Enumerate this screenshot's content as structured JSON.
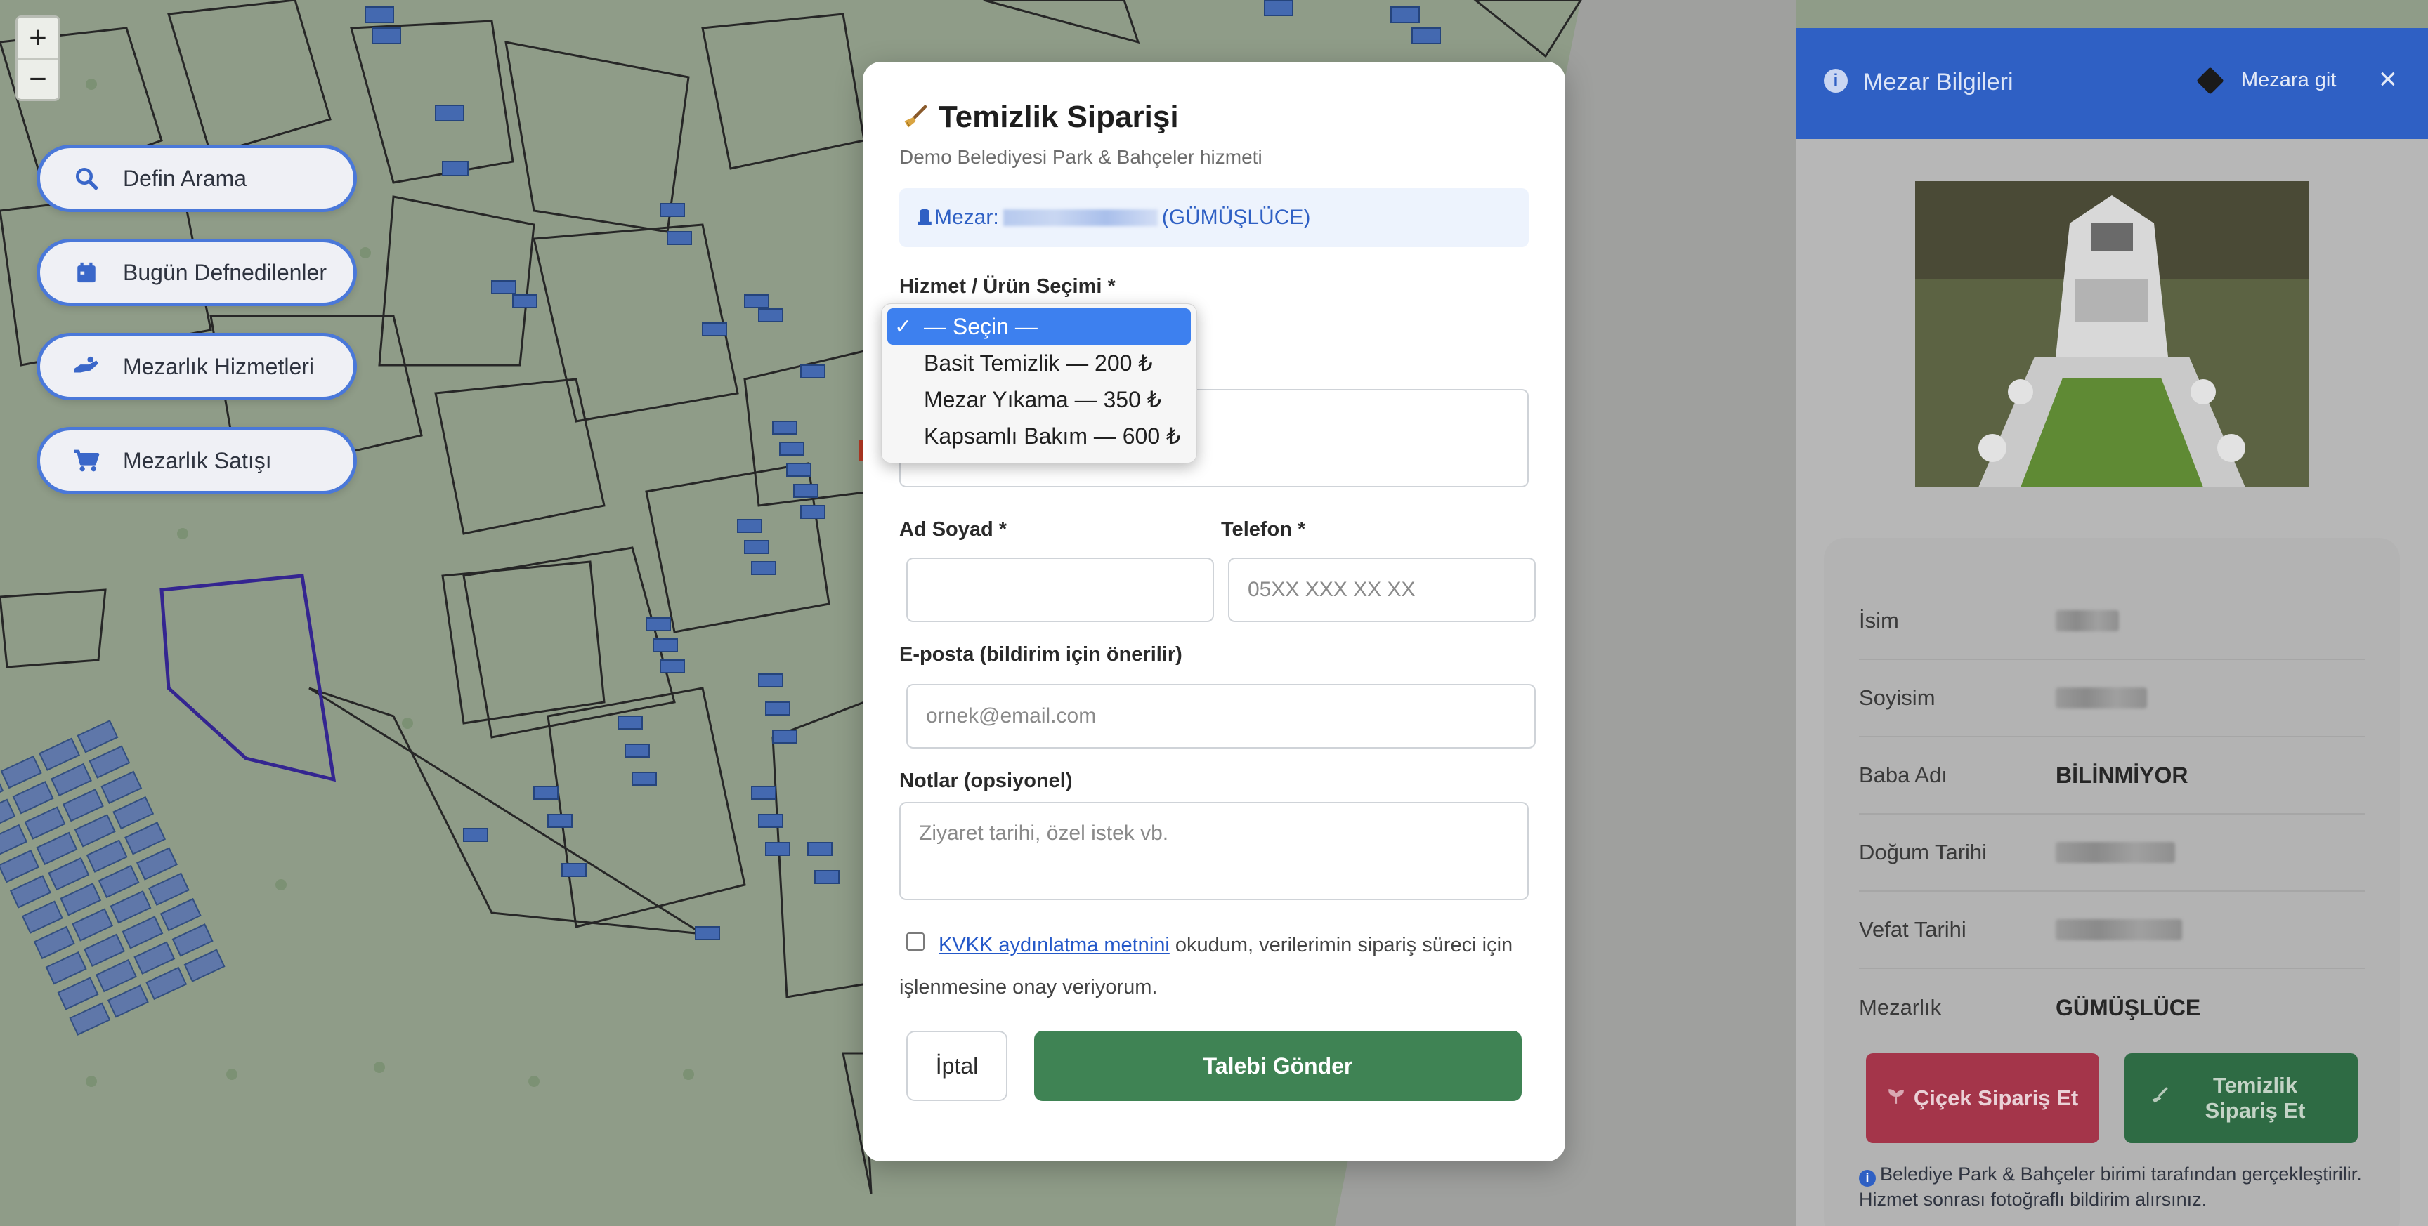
{
  "map": {
    "zoom_in": "+",
    "zoom_out": "−"
  },
  "left_menu": {
    "items": [
      {
        "label": "Defin Arama",
        "icon": "search-icon"
      },
      {
        "label": "Bugün Defnedilenler",
        "icon": "calendar-icon"
      },
      {
        "label": "Mezarlık Hizmetleri",
        "icon": "hand-service-icon"
      },
      {
        "label": "Mezarlık Satışı",
        "icon": "cart-icon"
      }
    ]
  },
  "modal": {
    "title": "Temizlik Siparişi",
    "subtitle": "Demo Belediyesi Park & Bahçeler hizmeti",
    "grave_prefix": "Mezar:",
    "grave_suffix": "(GÜMÜŞLÜCE)",
    "service_label": "Hizmet / Ürün Seçimi *",
    "name_label": "Ad Soyad *",
    "phone_label": "Telefon *",
    "phone_placeholder": "05XX XXX XX XX",
    "email_label": "E-posta (bildirim için önerilir)",
    "email_placeholder": "ornek@email.com",
    "notes_label": "Notlar (opsiyonel)",
    "notes_placeholder": "Ziyaret tarihi, özel istek vb.",
    "kvkk_link": "KVKK aydınlatma metnini",
    "kvkk_text": " okudum, verilerimin sipariş süreci için işlenmesine onay veriyorum.",
    "cancel": "İptal",
    "submit": "Talebi Gönder"
  },
  "dropdown": {
    "selected_index": 0,
    "check": "✓",
    "options": [
      "— Seçin —",
      "Basit Temizlik — 200 ₺",
      "Mezar Yıkama — 350 ₺",
      "Kapsamlı Bakım — 600 ₺"
    ]
  },
  "panel": {
    "title": "Mezar Bilgileri",
    "go_label": "Mezara git",
    "close": "×",
    "rows": [
      {
        "key": "İsim",
        "value": ""
      },
      {
        "key": "Soyisim",
        "value": ""
      },
      {
        "key": "Baba Adı",
        "value": "BİLİNMİYOR"
      },
      {
        "key": "Doğum Tarihi",
        "value": ""
      },
      {
        "key": "Vefat Tarihi",
        "value": ""
      },
      {
        "key": "Mezarlık",
        "value": "GÜMÜŞLÜCE"
      }
    ],
    "flower_button": "Çiçek Sipariş Et",
    "clean_button": "Temizlik Sipariş Et",
    "note": "Belediye Park & Bahçeler birimi tarafından gerçekleştirilir. Hizmet sonrası fotoğraflı bildirim alırsınız."
  },
  "colors": {
    "accent_blue": "#2f60c4",
    "submit_green": "#3f8354",
    "flower_red": "#a4354a",
    "clean_green": "#2e6b44"
  }
}
